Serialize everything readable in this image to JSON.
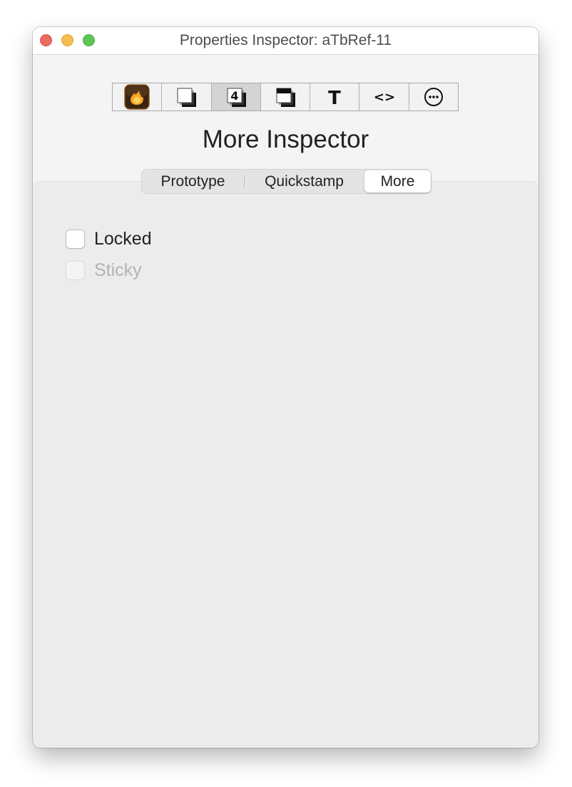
{
  "window": {
    "title": "Properties Inspector: aTbRef-11"
  },
  "toolbar": {
    "tabs": [
      {
        "icon": "appearance-flame-icon",
        "active": false
      },
      {
        "icon": "document-icon",
        "active": false
      },
      {
        "icon": "number-four-icon",
        "label": "4",
        "active": true
      },
      {
        "icon": "shadow-box-icon",
        "active": false
      },
      {
        "icon": "text-icon",
        "label": "T",
        "active": false
      },
      {
        "icon": "code-brackets-icon",
        "label": "<>",
        "active": false
      },
      {
        "icon": "more-ellipsis-icon",
        "active": false
      }
    ]
  },
  "inspector": {
    "heading": "More Inspector"
  },
  "segmented": {
    "items": [
      "Prototype",
      "Quickstamp",
      "More"
    ],
    "selected": "More"
  },
  "options": {
    "locked": {
      "label": "Locked",
      "checked": false,
      "enabled": true
    },
    "sticky": {
      "label": "Sticky",
      "checked": false,
      "enabled": false
    }
  },
  "colors": {
    "close": "#ed6a5e",
    "minimize": "#f5be4f",
    "zoom": "#61c554",
    "flame_bg": "#3a2312",
    "flame": "#f5a623"
  }
}
